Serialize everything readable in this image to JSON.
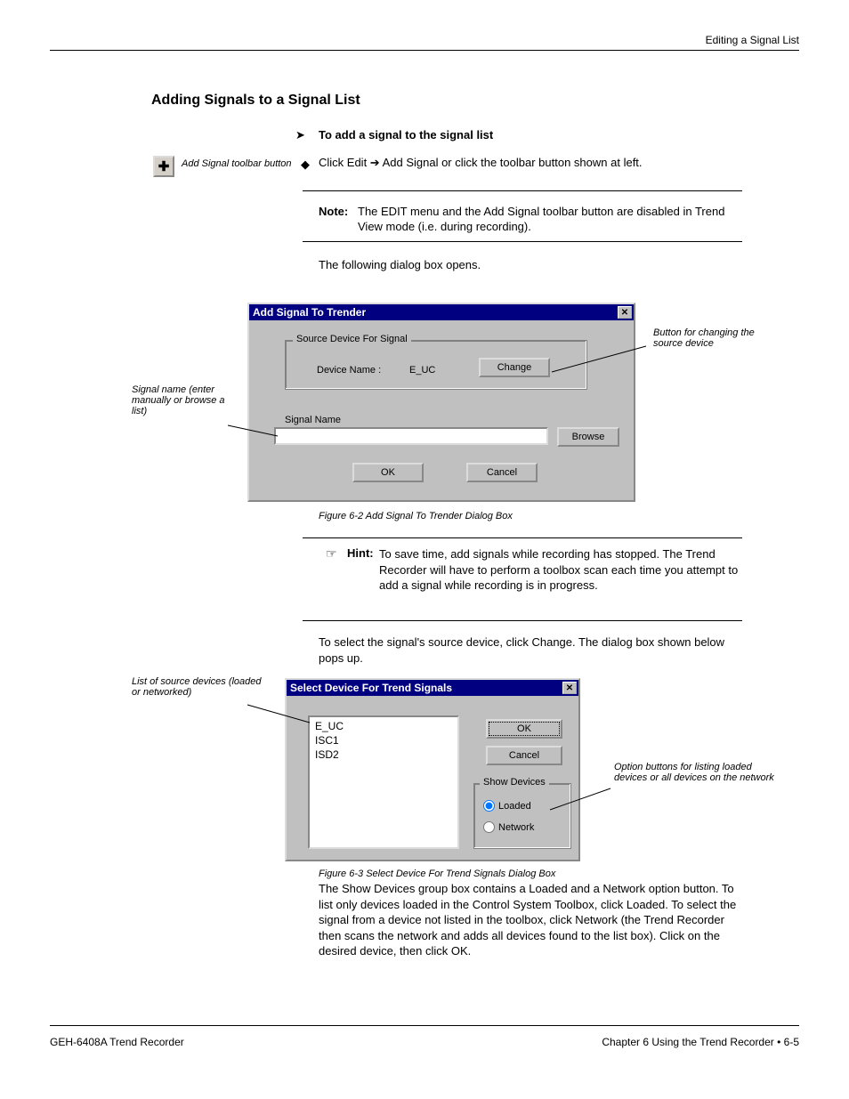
{
  "header": {
    "breadcrumb": "Editing a Signal List"
  },
  "section": {
    "title": "Adding Signals to a Signal List",
    "to_add": "To add a signal to the signal list",
    "plus_caption": "Add Signal toolbar button",
    "bullet1": "Click Edit ➔ Add Signal or click the toolbar button shown at left.",
    "note_label": "Note:",
    "note_text": "The EDIT menu and the Add Signal toolbar button are disabled in Trend View mode (i.e. during recording).",
    "after_note_text": "The following dialog box opens.",
    "fig1_caption": "Figure 6-2   Add Signal To Trender Dialog Box"
  },
  "dialog1": {
    "title": "Add Signal To Trender",
    "group_legend": "Source Device For Signal",
    "devname_label": "Device Name :",
    "devname_value": "E_UC",
    "change": "Change",
    "sig_label": "Signal Name",
    "browse": "Browse",
    "ok": "OK",
    "cancel": "Cancel"
  },
  "callouts": {
    "sig": "Signal name (enter manually or browse a list)",
    "change": "Button for changing the source device",
    "listsrc": "List of source devices (loaded or networked)",
    "showdev": "Option buttons for listing loaded devices or all devices on the network"
  },
  "hint": {
    "icon": "☞",
    "label": "Hint:",
    "text": "To save time, add signals while recording has stopped. The Trend Recorder will have to perform a toolbox scan each time you attempt to add a signal while recording is in progress."
  },
  "after_hint": "To select the signal's source device, click Change. The dialog box shown below pops up.",
  "dialog2": {
    "title": "Select Device For Trend Signals",
    "list_items": [
      "E_UC",
      "ISC1",
      "ISD2"
    ],
    "ok": "OK",
    "cancel": "Cancel",
    "group_legend": "Show Devices",
    "radio_loaded": "Loaded",
    "radio_network": "Network"
  },
  "fig2_caption": "Figure 6-3   Select Device For Trend Signals Dialog Box",
  "narrative": "The Show Devices group box contains a Loaded and a Network option button. To list only devices loaded in the Control System Toolbox, click Loaded. To select the signal from a device not listed in the toolbox, click Network (the Trend Recorder then scans the network and adds all devices found to the list box). Click on the desired device, then click OK.",
  "footer": {
    "left": "GEH-6408A   Trend Recorder",
    "right": "Chapter 6   Using the Trend Recorder • 6-5"
  }
}
